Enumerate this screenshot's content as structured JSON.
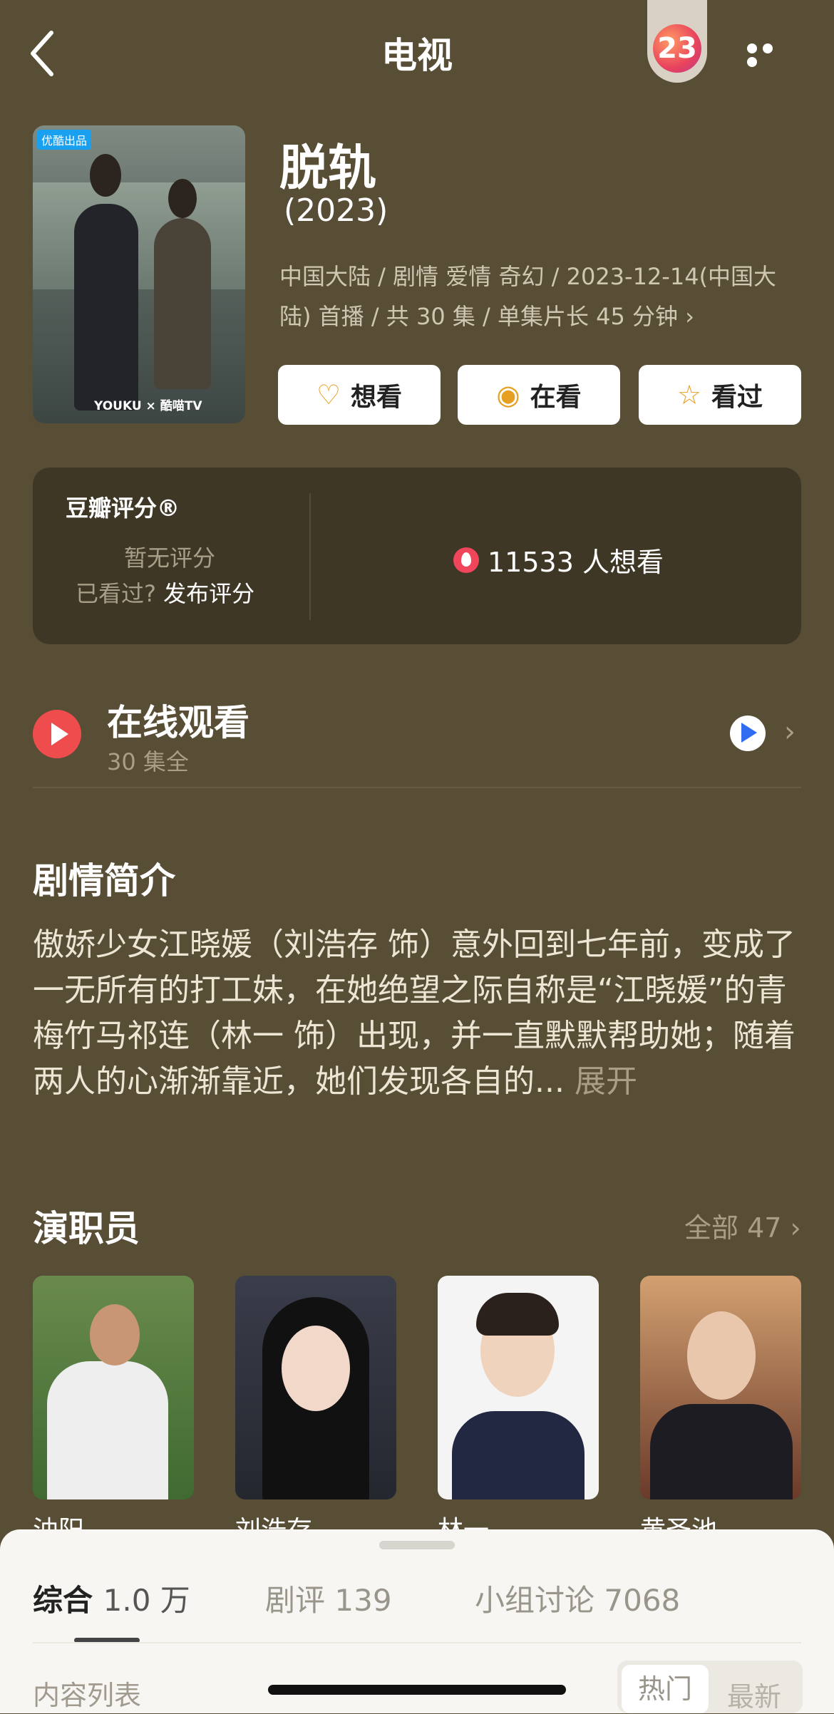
{
  "nav": {
    "title": "电视",
    "badge_text": "23"
  },
  "poster": {
    "tag": "优酷出品",
    "footer": "YOUKU × 酷喵TV"
  },
  "show": {
    "title": "脱轨",
    "year": "(2023)",
    "meta": "中国大陆 / 剧情 爱情 奇幻 / 2023-12-14(中国大陆) 首播 / 共 30 集 / 单集片长 45 分钟"
  },
  "buttons": {
    "want": "想看",
    "watching": "在看",
    "watched": "看过"
  },
  "rating": {
    "title": "豆瓣评分®",
    "no_score": "暂无评分",
    "seen_prompt": "已看过?",
    "publish": "发布评分",
    "want_count": "11533 人想看"
  },
  "online": {
    "title": "在线观看",
    "subtitle": "30 集全"
  },
  "synopsis": {
    "title": "剧情简介",
    "text": "傲娇少女江晓媛（刘浩存 饰）意外回到七年前，变成了一无所有的打工妹，在她绝望之际自称是“江晓媛”的青梅竹马祁连（林一 饰）出现，并一直默默帮助她；随着两人的心渐渐靠近，她们发现各自的...",
    "more": "展开"
  },
  "cast": {
    "title": "演职员",
    "all_label": "全部 47",
    "members": [
      "油阳",
      "刘浩存",
      "林一",
      "黄圣池"
    ]
  },
  "sheet": {
    "tabs": [
      {
        "label": "综合",
        "count": "1.0 万"
      },
      {
        "label": "剧评",
        "count": "139"
      },
      {
        "label": "小组讨论",
        "count": "7068"
      }
    ],
    "content_list": "内容列表",
    "sort_hot": "热门",
    "sort_new": "最新"
  },
  "colors": {
    "background": "#584d35",
    "accent": "#e6a021",
    "play": "#ef4d4d"
  }
}
